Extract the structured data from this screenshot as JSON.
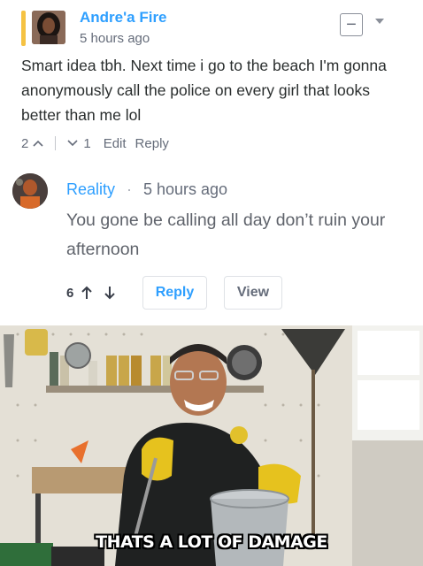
{
  "comment1": {
    "author": "Andre'a Fire",
    "time": "5 hours ago",
    "collapse_symbol": "−",
    "body": "Smart idea tbh. Next time i go to the beach I'm gonna anonymously call the police on every girl that looks better than me lol",
    "upvotes": "2",
    "upvote_icon": "^",
    "downvote_icon": "v",
    "downvotes": "1",
    "edit_label": "Edit",
    "reply_label": "Reply",
    "accent_color": "#f5c242",
    "link_color": "#2e9fff"
  },
  "comment2": {
    "author": "Reality",
    "separator": "·",
    "time": "5 hours ago",
    "body": "You gone be calling all day don’t ruin your afternoon",
    "votes": "6",
    "upvote_icon": "↑",
    "downvote_icon": "↓",
    "reply_label": "Reply",
    "view_label": "View"
  },
  "meme": {
    "caption": "THATS A LOT OF DAMAGE"
  }
}
